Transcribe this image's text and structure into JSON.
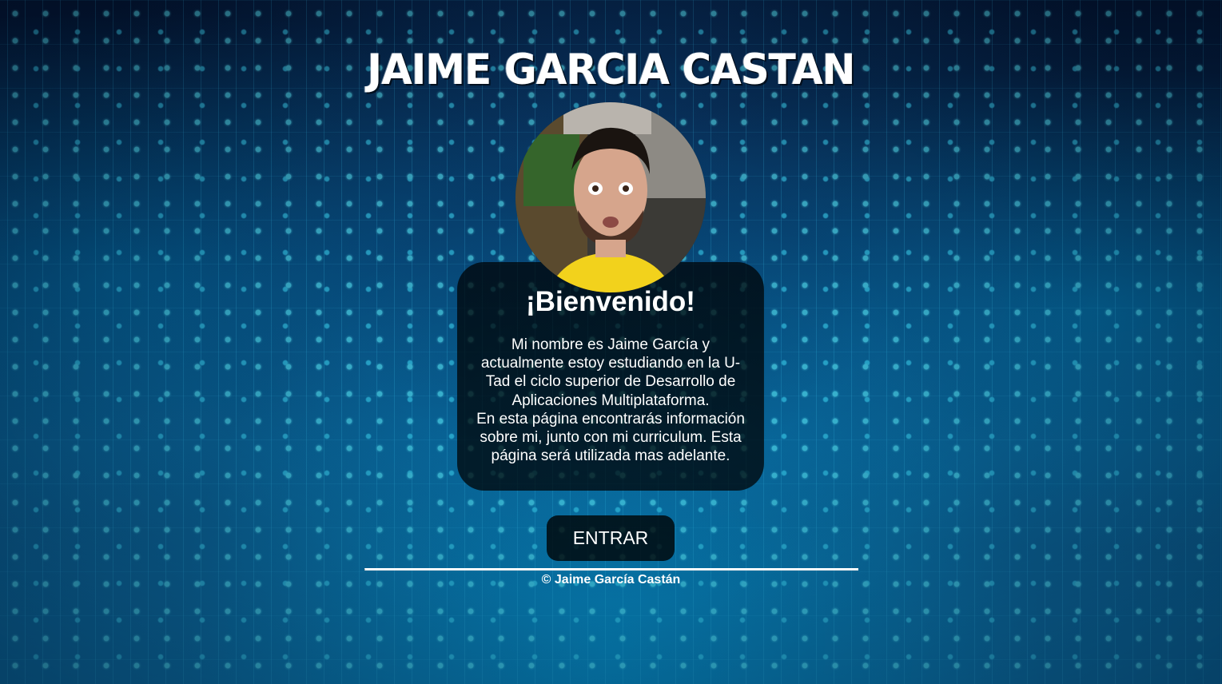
{
  "header": {
    "title": "JAIME GARCIA CASTAN"
  },
  "profile": {
    "avatar_icon": "profile-photo"
  },
  "welcome_card": {
    "heading": "¡Bienvenido!",
    "paragraph_1": "Mi nombre es Jaime García y actualmente estoy estudiando en la U-Tad el ciclo superior de Desarrollo de Aplicaciones Multiplataforma.",
    "paragraph_2": "En esta página encontrarás información sobre mi, junto con mi curriculum. Esta página será utilizada mas adelante."
  },
  "actions": {
    "enter_label": "ENTRAR"
  },
  "footer": {
    "copyright": "© Jaime García Castán"
  },
  "colors": {
    "text": "#ffffff",
    "card_background": "rgba(0,0,0,0.72)",
    "background_accent": "#0b6fa3",
    "circuit_glow": "#5ff3ff"
  }
}
